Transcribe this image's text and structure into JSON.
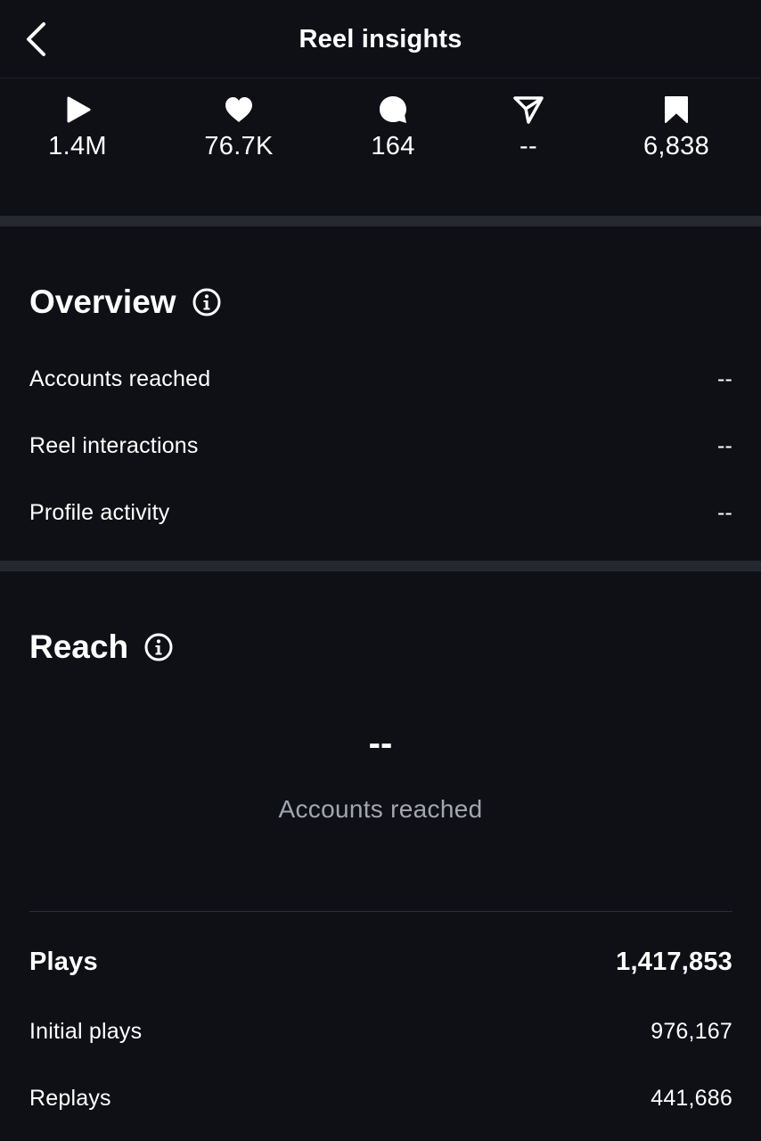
{
  "header": {
    "title": "Reel insights",
    "back_icon": "chevron-left-icon"
  },
  "metrics": [
    {
      "icon": "play-icon",
      "value": "1.4M"
    },
    {
      "icon": "heart-icon",
      "value": "76.7K"
    },
    {
      "icon": "comment-icon",
      "value": "164"
    },
    {
      "icon": "send-icon",
      "value": "--"
    },
    {
      "icon": "bookmark-icon",
      "value": "6,838"
    }
  ],
  "overview": {
    "title": "Overview",
    "rows": [
      {
        "label": "Accounts reached",
        "value": "--"
      },
      {
        "label": "Reel interactions",
        "value": "--"
      },
      {
        "label": "Profile activity",
        "value": "--"
      }
    ]
  },
  "reach": {
    "title": "Reach",
    "big_value": "--",
    "big_label": "Accounts reached",
    "plays": {
      "label": "Plays",
      "value": "1,417,853"
    },
    "rows": [
      {
        "label": "Initial plays",
        "value": "976,167"
      },
      {
        "label": "Replays",
        "value": "441,686"
      }
    ]
  },
  "colors": {
    "background": "#0e1016",
    "band": "#262830",
    "muted_text": "#a3a6b0"
  }
}
